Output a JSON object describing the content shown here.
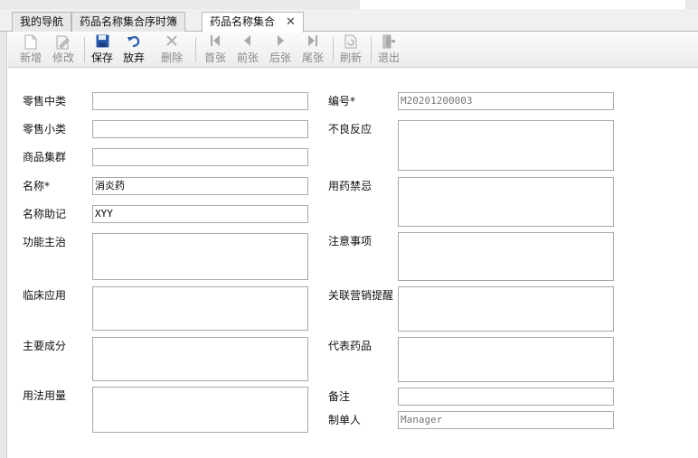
{
  "tabs": [
    {
      "label": "我的导航",
      "active": false,
      "closable": false
    },
    {
      "label": "药品名称集合序时簿",
      "active": false,
      "closable": false
    },
    {
      "label": "药品名称集合",
      "active": true,
      "closable": true,
      "close_glyph": "✕"
    }
  ],
  "toolbar": {
    "buttons": [
      {
        "label": "新增",
        "icon": "new-doc-icon",
        "enabled": false
      },
      {
        "label": "修改",
        "icon": "edit-icon",
        "enabled": false
      },
      {
        "label": "保存",
        "icon": "save-icon",
        "enabled": true
      },
      {
        "label": "放弃",
        "icon": "undo-icon",
        "enabled": true
      },
      {
        "label": "删除",
        "icon": "delete-icon",
        "enabled": false
      },
      {
        "label": "首张",
        "icon": "first-icon",
        "enabled": false
      },
      {
        "label": "前张",
        "icon": "prev-icon",
        "enabled": false
      },
      {
        "label": "后张",
        "icon": "next-icon",
        "enabled": false
      },
      {
        "label": "尾张",
        "icon": "last-icon",
        "enabled": false
      },
      {
        "label": "刷新",
        "icon": "refresh-icon",
        "enabled": false
      },
      {
        "label": "退出",
        "icon": "exit-icon",
        "enabled": false
      }
    ],
    "colors": {
      "enabled_icon": "#2a5db0",
      "disabled_icon": "#a9a9a9"
    }
  },
  "form": {
    "left": [
      {
        "label": "零售中类",
        "value": ""
      },
      {
        "label": "零售小类",
        "value": ""
      },
      {
        "label": "商品集群",
        "value": ""
      },
      {
        "label": "名称*",
        "value": "消炎药"
      },
      {
        "label": "名称助记",
        "value": "XYY"
      },
      {
        "label": "功能主治",
        "value": ""
      },
      {
        "label": "临床应用",
        "value": ""
      },
      {
        "label": "主要成分",
        "value": ""
      },
      {
        "label": "用法用量",
        "value": ""
      }
    ],
    "right": [
      {
        "label": "编号*",
        "value": "M20201200003"
      },
      {
        "label": "不良反应",
        "value": ""
      },
      {
        "label": "用药禁忌",
        "value": ""
      },
      {
        "label": "注意事项",
        "value": ""
      },
      {
        "label": "关联营销提醒",
        "value": ""
      },
      {
        "label": "代表药品",
        "value": ""
      },
      {
        "label": "备注",
        "value": ""
      },
      {
        "label": "制单人",
        "value": "Manager"
      }
    ]
  }
}
